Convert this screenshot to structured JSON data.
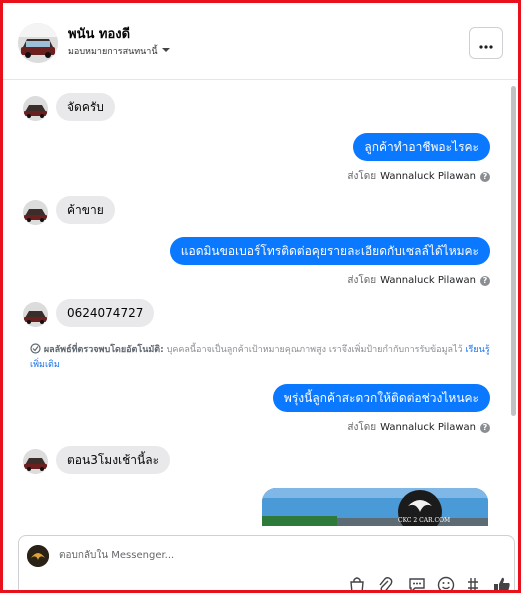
{
  "header": {
    "contact_name": "พนัน ทองดี",
    "assign_label": "มอบหมายการสนทนานี้"
  },
  "messages": [
    {
      "direction": "in",
      "text": "จัดครับ"
    },
    {
      "direction": "out",
      "text": "ลูกค้าทำอาชีพอะไรคะ",
      "sent_prefix": "ส่งโดย",
      "sender": "Wannaluck Pilawan"
    },
    {
      "direction": "in",
      "text": "ค้าขาย"
    },
    {
      "direction": "out",
      "text": "แอดมินขอเบอร์โทรติดต่อคุยรายละเอียดกับเซลล์ได้ไหมคะ",
      "sent_prefix": "ส่งโดย",
      "sender": "Wannaluck Pilawan"
    },
    {
      "direction": "in",
      "text": "0624074727"
    },
    {
      "direction": "out",
      "text": "พรุ่งนี้ลูกค้าสะดวกให้ติดต่อช่วงไหนคะ",
      "sent_prefix": "ส่งโดย",
      "sender": "Wannaluck Pilawan"
    },
    {
      "direction": "in",
      "text": "ตอน3โมงเช้านี้ละ"
    }
  ],
  "auto_detect_note": {
    "title": "ผลลัพธ์ที่ตรวจพบโดยอัตโนมัติ:",
    "body": "บุคคลนี้อาจเป็นลูกค้าเป้าหมายคุณภาพสูง เราจึงเพิ่มป้ายกำกับการรับข้อมูลไว้",
    "learn_more": "เรียนรู้เพิ่มเติม"
  },
  "image_card": {
    "logo_text": "CKC 2 CAR.COM"
  },
  "composer": {
    "placeholder": "ตอบกลับใน Messenger..."
  },
  "icons": [
    "avatar",
    "chevron-down-icon",
    "more-icon",
    "info-icon",
    "shopping-bag-icon",
    "attachment-icon",
    "saved-reply-icon",
    "emoji-icon",
    "hashtag-icon",
    "like-icon"
  ],
  "colors": {
    "outgoing_bubble": "#0a78ff",
    "incoming_bubble": "#e9e9eb",
    "frame_border": "#e8101a"
  }
}
